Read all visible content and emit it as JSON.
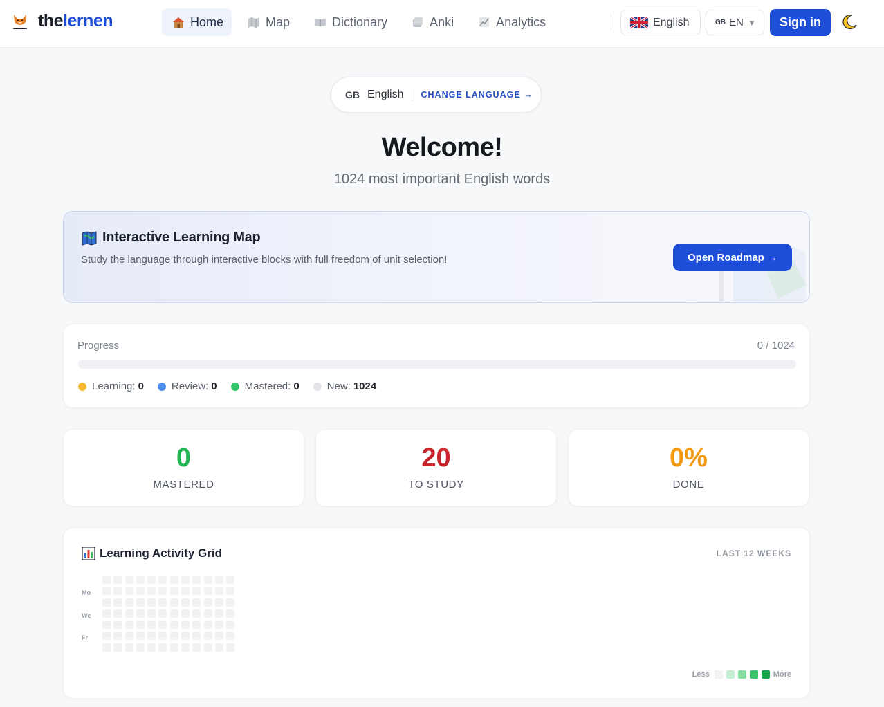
{
  "brand": {
    "prefix": "the",
    "suffix": "lernen"
  },
  "nav": [
    {
      "label": "Home",
      "icon": "home-icon",
      "active": true
    },
    {
      "label": "Map",
      "icon": "map-icon",
      "active": false
    },
    {
      "label": "Dictionary",
      "icon": "book-icon",
      "active": false
    },
    {
      "label": "Anki",
      "icon": "cards-icon",
      "active": false
    },
    {
      "label": "Analytics",
      "icon": "chart-icon",
      "active": false
    }
  ],
  "header": {
    "language_label": "English",
    "locale_code": "GB",
    "locale_label": "EN",
    "signin_label": "Sign in",
    "theme_icon": "moon-icon"
  },
  "hero": {
    "country_code": "GB",
    "language": "English",
    "change_label": "CHANGE LANGUAGE →",
    "title": "Welcome!",
    "subtitle": "1024 most important English words"
  },
  "map_card": {
    "title": "Interactive Learning Map",
    "description": "Study the language through interactive blocks with full freedom of unit selection!",
    "button_label": "Open Roadmap →"
  },
  "progress": {
    "label": "Progress",
    "count": "0 / 1024",
    "fraction": 0,
    "legend": [
      {
        "label": "Learning:",
        "value": "0",
        "color": "#f5b82e"
      },
      {
        "label": "Review:",
        "value": "0",
        "color": "#4f8ff0"
      },
      {
        "label": "Mastered:",
        "value": "0",
        "color": "#34c66a"
      },
      {
        "label": "New:",
        "value": "1024",
        "color": "#e2e4e8"
      }
    ]
  },
  "stats": [
    {
      "value": "0",
      "caption": "MASTERED",
      "color": "#22b455"
    },
    {
      "value": "20",
      "caption": "TO STUDY",
      "color": "#c8262c"
    },
    {
      "value": "0%",
      "caption": "DONE",
      "color": "#f29a12"
    }
  ],
  "activity": {
    "title": "Learning Activity Grid",
    "range": "LAST 12 WEEKS",
    "days": [
      "Mo",
      "We",
      "Fr"
    ],
    "weeks": 12,
    "less_label": "Less",
    "more_label": "More",
    "scale_colors": [
      "#f1f2f4",
      "#c6f0d3",
      "#86e0a4",
      "#3cc46c",
      "#17a34a"
    ]
  }
}
